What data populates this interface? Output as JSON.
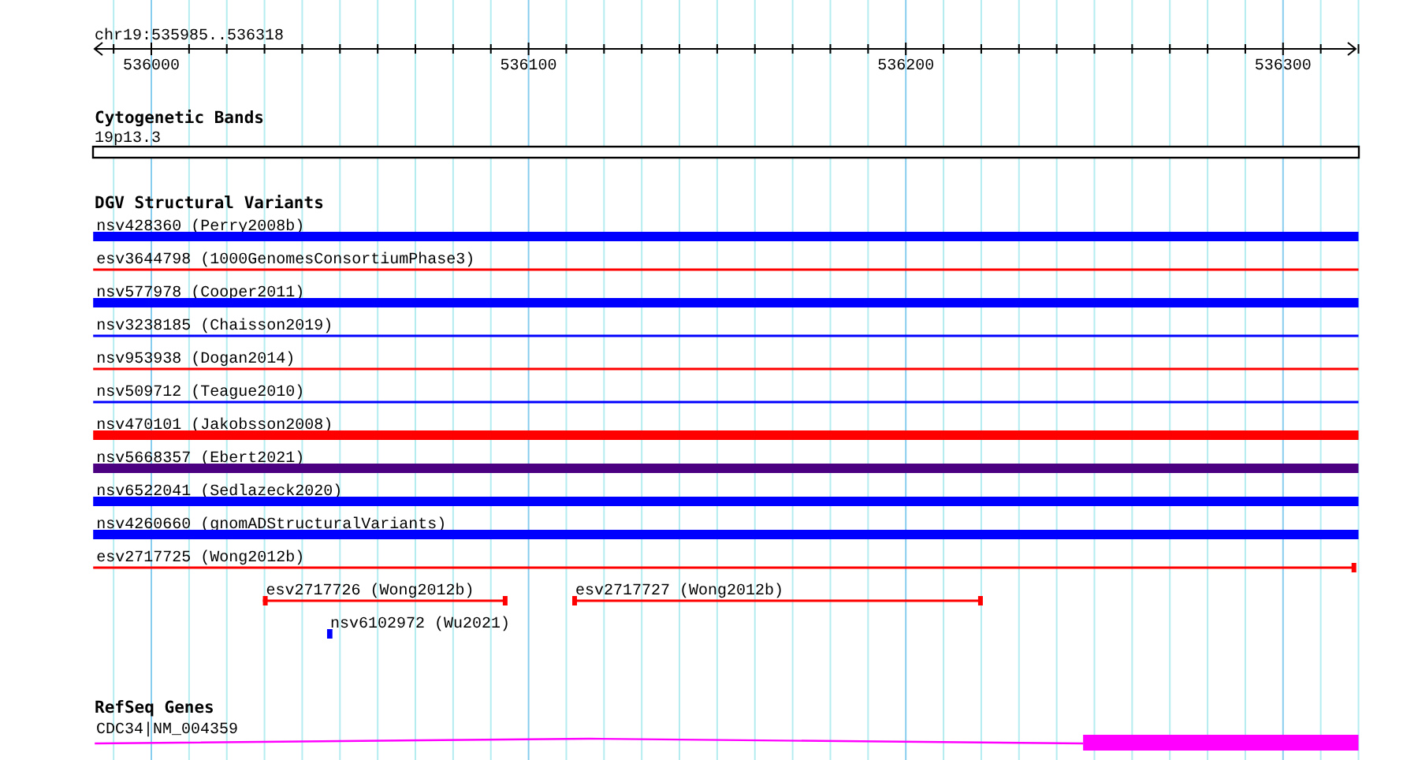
{
  "ruler": {
    "region": "chr19:535985..536318",
    "labels": [
      "536000",
      "536100",
      "536200",
      "536300"
    ]
  },
  "tracks": [
    {
      "title": "Cytogenetic Bands",
      "kind": "ideogram",
      "features": [
        {
          "label": "19p13.3"
        }
      ]
    },
    {
      "title": "DGV Structural Variants",
      "kind": "variants",
      "features": [
        {
          "label": "nsv428360 (Perry2008b)",
          "kind": "bar",
          "color": "#0000ff"
        },
        {
          "label": "esv3644798 (1000GenomesConsortiumPhase3)",
          "kind": "line",
          "color": "#ff0000"
        },
        {
          "label": "nsv577978 (Cooper2011)",
          "kind": "bar",
          "color": "#0000ff"
        },
        {
          "label": "nsv3238185 (Chaisson2019)",
          "kind": "line",
          "color": "#0000ff"
        },
        {
          "label": "nsv953938 (Dogan2014)",
          "kind": "line",
          "color": "#ff0000"
        },
        {
          "label": "nsv509712 (Teague2010)",
          "kind": "line",
          "color": "#0000ff"
        },
        {
          "label": "nsv470101 (Jakobsson2008)",
          "kind": "bar",
          "color": "#ff0000"
        },
        {
          "label": "nsv5668357 (Ebert2021)",
          "kind": "bar",
          "color": "#4b0082"
        },
        {
          "label": "nsv6522041 (Sedlazeck2020)",
          "kind": "bar",
          "color": "#0000ff"
        },
        {
          "label": "nsv4260660 (gnomADStructuralVariants)",
          "kind": "bar",
          "color": "#0000ff"
        },
        {
          "label": "esv2717725 (Wong2012b)",
          "kind": "line",
          "color": "#ff0000"
        },
        {
          "label": "esv2717726 (Wong2012b)",
          "kind": "line",
          "color": "#ff0000"
        },
        {
          "label": "esv2717727 (Wong2012b)",
          "kind": "line",
          "color": "#ff0000"
        },
        {
          "label": "nsv6102972 (Wu2021)",
          "kind": "bar",
          "color": "#0000ff"
        }
      ]
    },
    {
      "title": "RefSeq Genes",
      "kind": "genes",
      "features": [
        {
          "label": "CDC34|NM_004359"
        }
      ]
    }
  ]
}
